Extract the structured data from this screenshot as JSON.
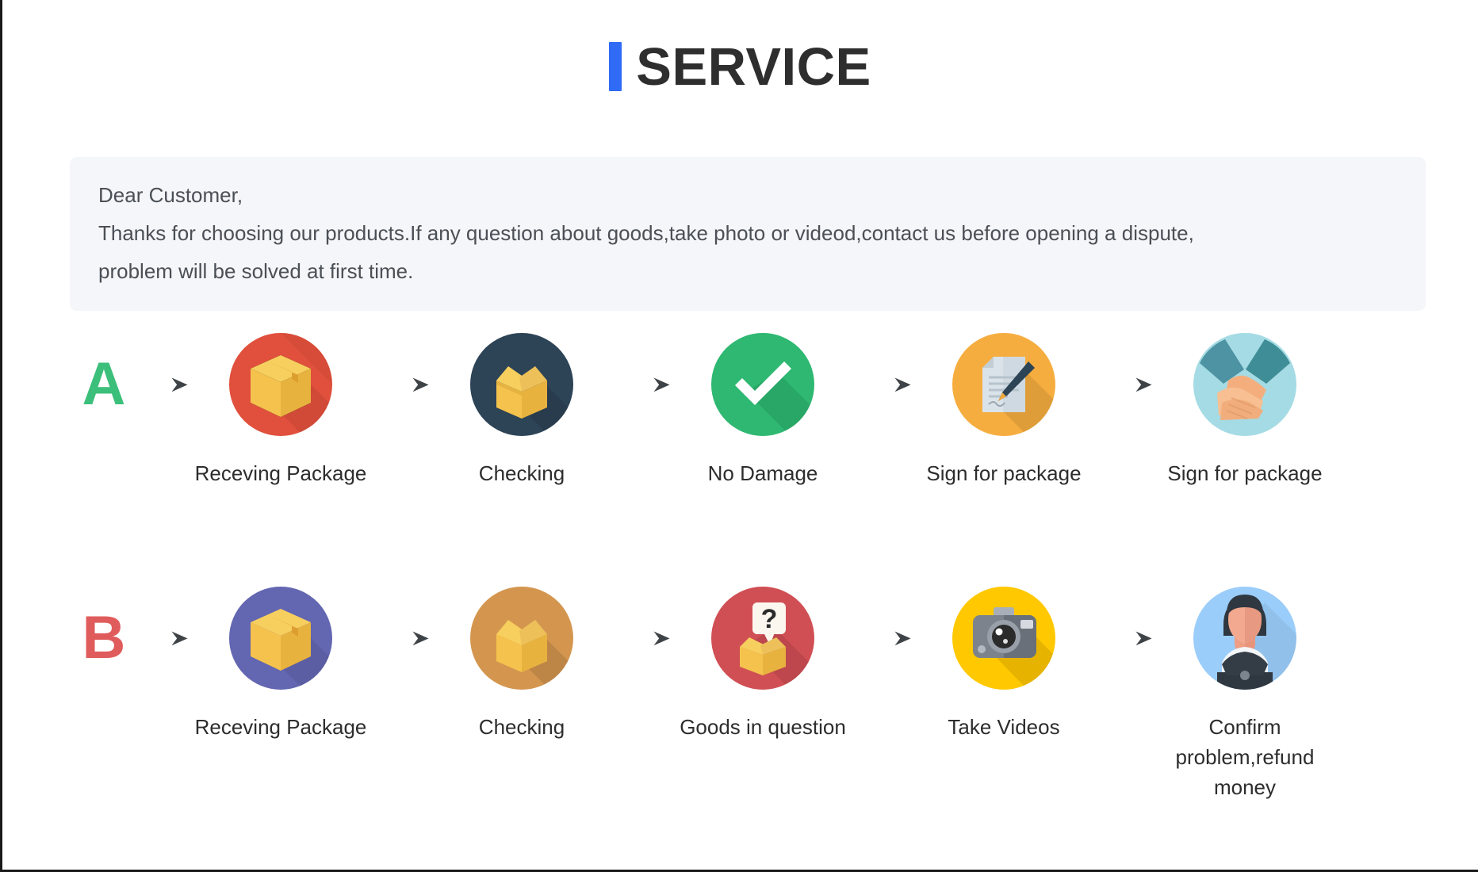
{
  "header": {
    "accent_color": "#2f6bf5",
    "title": "SERVICE"
  },
  "notice": {
    "background_color": "#f4f6f9",
    "lines": [
      "Dear Customer,",
      "Thanks for choosing our products.If any question about goods,take photo or videod,contact us before opening a dispute,",
      "problem will be solved at first time."
    ]
  },
  "flows": [
    {
      "letter": "A",
      "letter_color": "#3cbf7a",
      "steps": [
        {
          "label": "Receving Package",
          "icon": "package-box-icon",
          "circle_color": "#e0503c"
        },
        {
          "label": "Checking",
          "icon": "open-box-icon",
          "circle_color": "#2d4356"
        },
        {
          "label": "No Damage",
          "icon": "check-mark-icon",
          "circle_color": "#2eb872"
        },
        {
          "label": "Sign for package",
          "icon": "document-pen-icon",
          "circle_color": "#f6ad3f"
        },
        {
          "label": "Sign for package",
          "icon": "handshake-icon",
          "circle_color": "#a5dbe4"
        }
      ]
    },
    {
      "letter": "B",
      "letter_color": "#e05c5c",
      "steps": [
        {
          "label": "Receving Package",
          "icon": "package-box-icon",
          "circle_color": "#6366b0"
        },
        {
          "label": "Checking",
          "icon": "open-box-icon",
          "circle_color": "#d4964f"
        },
        {
          "label": "Goods in question",
          "icon": "question-box-icon",
          "circle_color": "#d04f54"
        },
        {
          "label": "Take Videos",
          "icon": "camera-icon",
          "circle_color": "#ffc800"
        },
        {
          "label": "Confirm problem,refund money",
          "icon": "support-person-icon",
          "circle_color": "#9bcdfa"
        }
      ]
    }
  ],
  "arrow": {
    "name": "right-arrow-icon",
    "color": "#3e4347"
  }
}
